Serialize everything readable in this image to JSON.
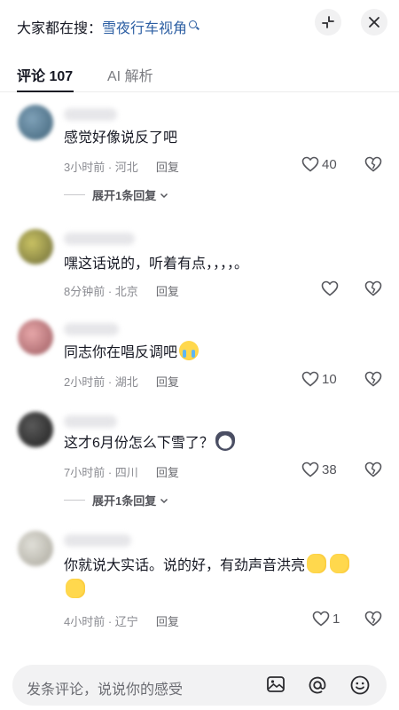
{
  "header": {
    "search_prefix": "大家都在搜：",
    "search_keyword": "雪夜行车视角"
  },
  "tabs": [
    {
      "label": "评论 107",
      "active": true
    },
    {
      "label": "AI 解析",
      "active": false
    }
  ],
  "comments": [
    {
      "text": "感觉好像说反了吧",
      "time": "3小时前",
      "location": "河北",
      "reply": "回复",
      "likes": "40",
      "expand": "展开1条回复"
    },
    {
      "text": "嘿这话说的，听着有点，，，，。",
      "time": "8分钟前",
      "location": "北京",
      "reply": "回复",
      "likes": ""
    },
    {
      "text": "同志你在唱反调吧",
      "time": "2小时前",
      "location": "湖北",
      "reply": "回复",
      "likes": "10"
    },
    {
      "text": "这才6月份怎么下雪了？",
      "time": "7小时前",
      "location": "四川",
      "reply": "回复",
      "likes": "38",
      "expand": "展开1条回复"
    },
    {
      "text": "你就说大实话。说的好，有劲声音洪亮",
      "time": "4小时前",
      "location": "辽宁",
      "reply": "回复",
      "likes": "1"
    }
  ],
  "meta_separator": " · ",
  "composer": {
    "placeholder": "发条评论，说说你的感受"
  },
  "icons": [
    "collapse-icon",
    "close-icon",
    "search-keyword-icon",
    "heart-icon",
    "broken-heart-icon",
    "chevron-down-icon",
    "image-icon",
    "at-icon",
    "emoji-icon"
  ],
  "colors": {
    "keyword": "#2d5fa3",
    "text": "#161823",
    "meta": "#8a8b91"
  }
}
